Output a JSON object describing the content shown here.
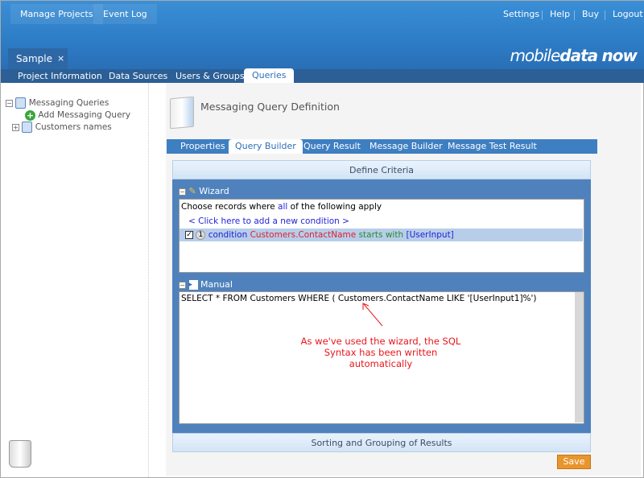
{
  "header": {
    "top_buttons": [
      "Manage Projects",
      "Event Log"
    ],
    "right_links": [
      "Settings",
      "Help",
      "Buy",
      "Logout"
    ],
    "logo": "mobiledatanow"
  },
  "project_tab": {
    "label": "Sample",
    "close": "×"
  },
  "subnav": [
    "Project Information",
    "Data Sources",
    "Users & Groups",
    "Queries"
  ],
  "tree": {
    "root": "Messaging Queries",
    "add": "Add Messaging Query",
    "item": "Customers names",
    "collapse": "−",
    "expand": "+"
  },
  "page_title": "Messaging Query Definition",
  "query_tabs": [
    "Properties",
    "Query Builder",
    "Query Result",
    "Message Builder",
    "Message Test Result"
  ],
  "define_criteria": "Define Criteria",
  "wizard": {
    "label": "Wizard",
    "choose_prefix": "Choose records where",
    "choose_all": "all",
    "choose_suffix": "of the following apply",
    "add_condition": "< Click here to add a new condition >",
    "condition": {
      "num": "1",
      "word": "condition",
      "field": "Customers.ContactName",
      "op": "starts with",
      "value": "[UserInput]"
    }
  },
  "manual": {
    "label": "Manual",
    "sql": "SELECT * FROM Customers WHERE ( Customers.ContactName  LIKE '[UserInput1]%')"
  },
  "annotation": "As we've used the wizard, the SQL Syntax has been written automatically",
  "sorting": "Sorting and Grouping of Results",
  "save": "Save"
}
